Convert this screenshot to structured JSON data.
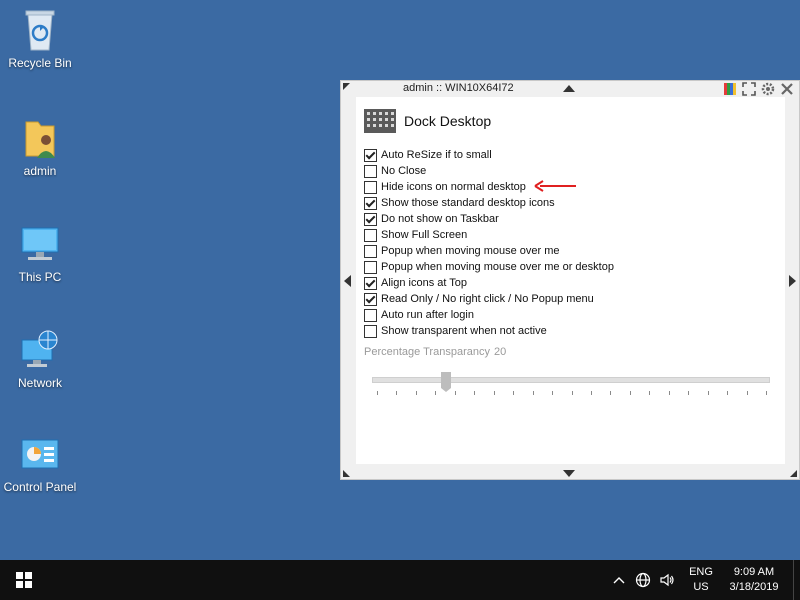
{
  "desktop": {
    "icons": [
      {
        "label": "Recycle Bin",
        "icon": "recycle-bin-icon"
      },
      {
        "label": "admin",
        "icon": "user-folder-icon"
      },
      {
        "label": "This PC",
        "icon": "this-pc-icon"
      },
      {
        "label": "Network",
        "icon": "network-icon"
      },
      {
        "label": "Control Panel",
        "icon": "control-panel-icon"
      }
    ]
  },
  "dock": {
    "title": "admin :: WIN10X64I72",
    "header_title": "Dock Desktop",
    "options": [
      {
        "label": "Auto ReSize if to small",
        "checked": true
      },
      {
        "label": "No Close",
        "checked": false
      },
      {
        "label": "Hide icons on normal desktop",
        "checked": false
      },
      {
        "label": "Show those standard desktop icons",
        "checked": true
      },
      {
        "label": "Do not show on Taskbar",
        "checked": true
      },
      {
        "label": "Show Full Screen",
        "checked": false
      },
      {
        "label": "Popup when moving mouse over me",
        "checked": false
      },
      {
        "label": "Popup when moving mouse over me or desktop",
        "checked": false
      },
      {
        "label": "Align icons at Top",
        "checked": true
      },
      {
        "label": "Read Only / No right click / No Popup menu",
        "checked": true
      },
      {
        "label": "Auto run after login",
        "checked": false
      },
      {
        "label": "Show transparent when not active",
        "checked": false
      }
    ],
    "transparency_label": "Percentage Transparancy",
    "transparency_value": "20",
    "slider_fraction": 0.2,
    "annotation_arrow_color": "#e02020"
  },
  "taskbar": {
    "lang_line1": "ENG",
    "lang_line2": "US",
    "time": "9:09 AM",
    "date": "3/18/2019"
  },
  "colors": {
    "desktop_bg": "#3b6aa3",
    "taskbar_bg": "#101010"
  }
}
